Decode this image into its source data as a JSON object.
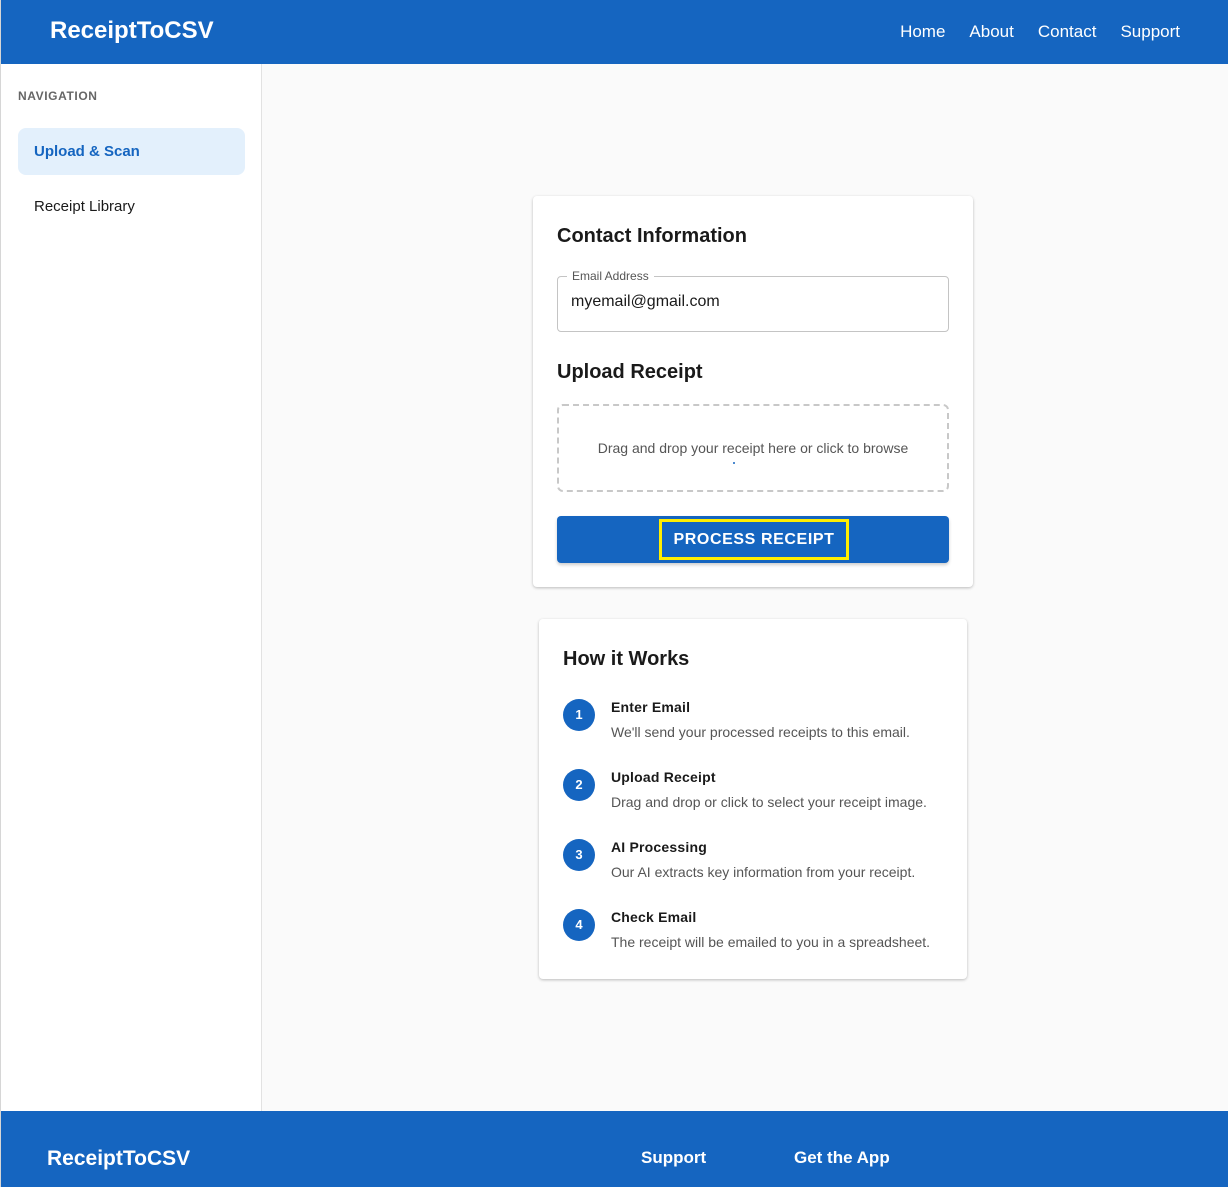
{
  "header": {
    "brand": "ReceiptToCSV",
    "nav": [
      "Home",
      "About",
      "Contact",
      "Support"
    ]
  },
  "sidebar": {
    "title": "NAVIGATION",
    "items": [
      {
        "label": "Upload & Scan",
        "active": true
      },
      {
        "label": "Receipt Library",
        "active": false
      }
    ]
  },
  "contact": {
    "title": "Contact Information",
    "email_label": "Email Address",
    "email_value": "myemail@gmail.com"
  },
  "upload": {
    "title": "Upload Receipt",
    "dropzone_text": "Drag and drop your receipt here or click to browse",
    "process_label": "PROCESS RECEIPT"
  },
  "how": {
    "title": "How it Works",
    "steps": [
      {
        "num": "1",
        "title": "Enter Email",
        "desc": "We'll send your processed receipts to this email."
      },
      {
        "num": "2",
        "title": "Upload Receipt",
        "desc": "Drag and drop or click to select your receipt image."
      },
      {
        "num": "3",
        "title": "AI Processing",
        "desc": "Our AI extracts key information from your receipt."
      },
      {
        "num": "4",
        "title": "Check Email",
        "desc": "The receipt will be emailed to you in a spreadsheet."
      }
    ]
  },
  "footer": {
    "brand": "ReceiptToCSV",
    "columns": [
      "Support",
      "Get the App"
    ]
  },
  "colors": {
    "primary": "#1565c0",
    "highlight": "#ffee00",
    "active_bg": "#e3f0fc"
  }
}
